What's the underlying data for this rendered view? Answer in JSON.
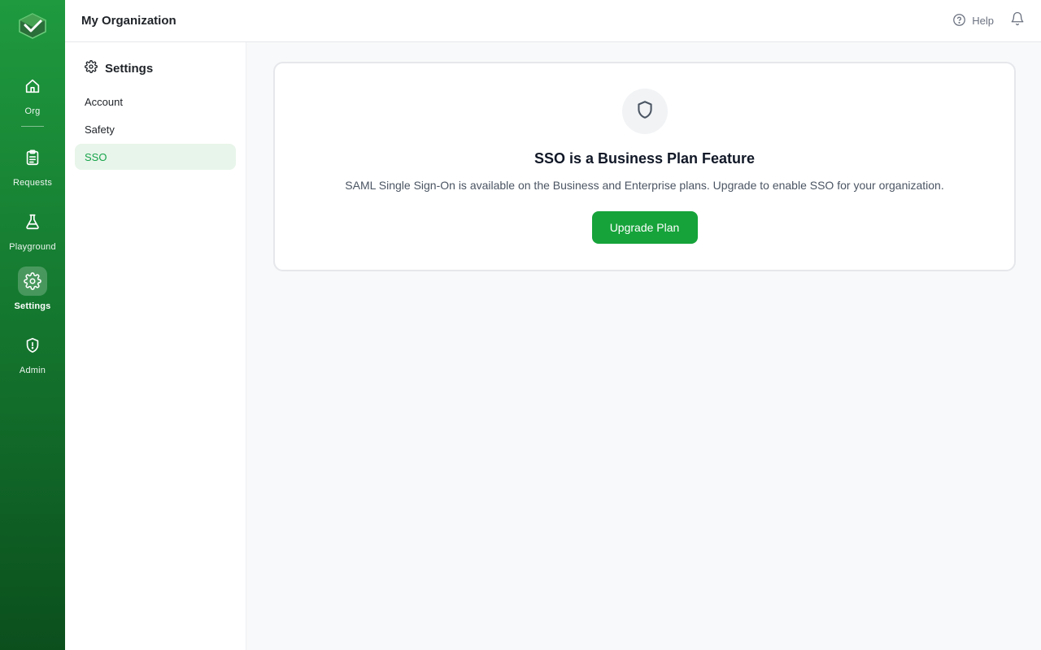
{
  "org_title": "My Organization",
  "header": {
    "help_label": "Help"
  },
  "rail": {
    "items": [
      {
        "label": "Org",
        "icon": "home-icon"
      },
      {
        "label": "Requests",
        "icon": "clipboard-icon"
      },
      {
        "label": "Playground",
        "icon": "flask-icon"
      },
      {
        "label": "Settings",
        "icon": "gear-icon",
        "active": true
      },
      {
        "label": "Admin",
        "icon": "shield-alert-icon"
      }
    ]
  },
  "settings_nav": {
    "title": "Settings",
    "items": [
      {
        "label": "Account"
      },
      {
        "label": "Safety"
      },
      {
        "label": "SSO",
        "active": true
      }
    ]
  },
  "sso_card": {
    "title": "SSO is a Business Plan Feature",
    "description": "SAML Single Sign-On is available on the Business and Enterprise plans. Upgrade to enable SSO for your organization.",
    "button_label": "Upgrade Plan"
  },
  "colors": {
    "brand_green": "#16a33a",
    "rail_gradient_top": "#1f9a3f",
    "rail_gradient_bottom": "#0b4f1d",
    "active_nav_bg": "#e8f5ea"
  }
}
